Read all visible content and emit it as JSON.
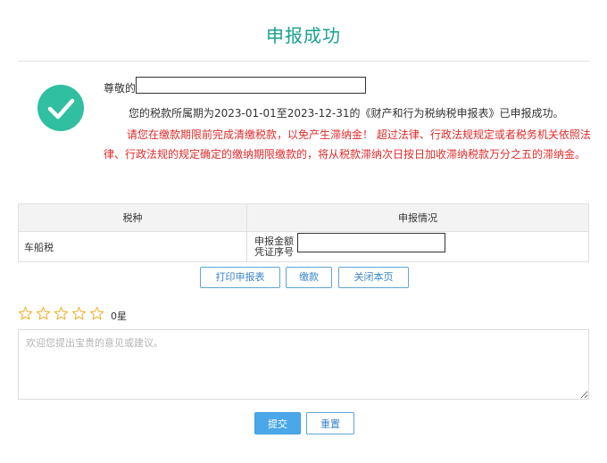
{
  "page": {
    "title": "申报成功"
  },
  "message": {
    "greeting": "尊敬的",
    "success_text": "您的税款所属期为2023-01-01至2023-12-31的《财产和行为税纳税申报表》已申报成功。",
    "warning_text": "请您在缴款期限前完成清缴税款，以免产生滞纳金！ 超过法律、行政法规规定或者税务机关依照法律、行政法规的规定确定的缴纳期限缴款的，将从税款滞纳次日按日加收滞纳税款万分之五的滞纳金。"
  },
  "table": {
    "headers": [
      "税种",
      "申报情况"
    ],
    "rows": [
      {
        "tax_type": "车船税",
        "declare_amount_label": "申报金额",
        "voucher_label": "凭证序号"
      }
    ]
  },
  "actions": {
    "print_label": "打印申报表",
    "pay_label": "缴款",
    "close_label": "关闭本页"
  },
  "rating": {
    "star_count": 5,
    "value": 0,
    "label": "0星"
  },
  "feedback": {
    "placeholder": "欢迎您提出宝贵的意见或建议。",
    "value": "",
    "submit_label": "提交",
    "reset_label": "重置"
  },
  "colors": {
    "accent": "#1aa191",
    "success_icon": "#30bfa1",
    "warning": "#e02b2b",
    "button_border": "#5ea6d6",
    "primary_button": "#4aa8e8",
    "star_outline": "#f0b43c"
  }
}
